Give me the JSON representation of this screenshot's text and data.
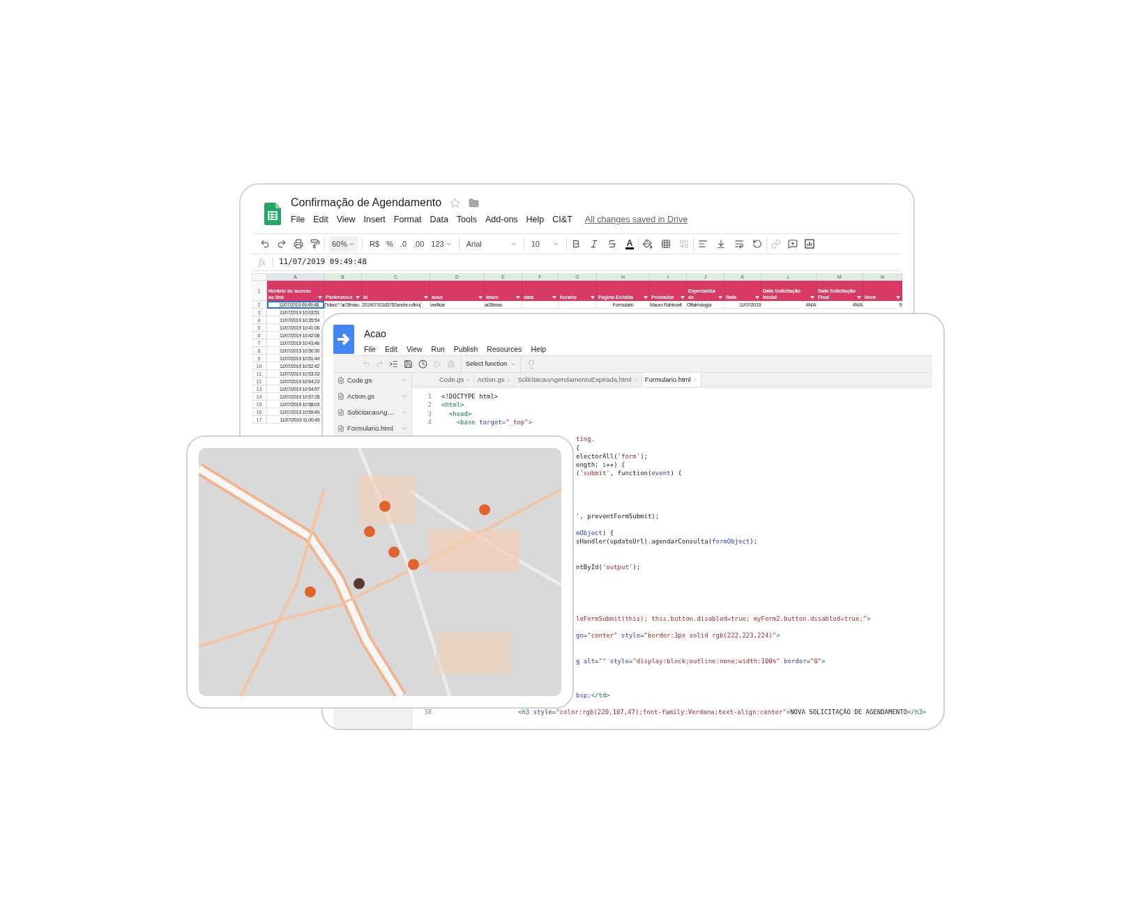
{
  "sheet_window": {
    "title": "Confirmação de Agendamento",
    "menu": [
      "File",
      "Edit",
      "View",
      "Insert",
      "Format",
      "Data",
      "Tools",
      "Add-ons",
      "Help",
      "CI&T"
    ],
    "save_status": "All changes saved in Drive",
    "toolbar": {
      "zoom": "60%",
      "currency": "R$",
      "percent": "%",
      "decrease_decimals": ".0",
      "increase_decimals": ".00",
      "more_formats": "123",
      "font": "Arial",
      "font_size": "10",
      "text_color": "A"
    },
    "formula_bar": {
      "label": "fx",
      "value": "11/07/2019 09:49:48"
    },
    "columns": [
      "A",
      "B",
      "C",
      "D",
      "E",
      "F",
      "G",
      "H",
      "I",
      "J",
      "K",
      "L",
      "M",
      "N"
    ],
    "header_row": {
      "number": "1",
      "cells": [
        "Horário do acesso ao link",
        "Parâmetros",
        "id",
        "acao",
        "idsec",
        "data",
        "horario",
        "Página Exibida",
        "Prestador",
        "Especialidade",
        "Data",
        "Data Solicitação Inicial",
        "Data Solicitação Final",
        "Hora"
      ]
    },
    "rows": [
      {
        "number": "2",
        "selected": true,
        "cells": [
          "11/07/2019 09:49:48",
          "{\"idsec\":\"ar28mau",
          "20190710183752andre.rufino(",
          "verificar",
          "ar28mau",
          null,
          null,
          "Formulário",
          "Mauro Rabinovit",
          "Oftalmologia",
          "11/07/2019",
          "#N/A",
          "#N/A",
          "9"
        ]
      },
      {
        "number": "3",
        "selected": false,
        "cells": [
          "11/07/2019 10:03:51"
        ]
      },
      {
        "number": "4",
        "selected": false,
        "cells": [
          "11/07/2019 10:35:54"
        ]
      },
      {
        "number": "5",
        "selected": false,
        "cells": [
          "11/07/2019 10:41:06"
        ]
      },
      {
        "number": "6",
        "selected": false,
        "cells": [
          "11/07/2019 10:42:08"
        ]
      },
      {
        "number": "7",
        "selected": false,
        "cells": [
          "11/07/2019 10:43:46"
        ]
      },
      {
        "number": "8",
        "selected": false,
        "cells": [
          "11/07/2019 10:50:30"
        ]
      },
      {
        "number": "9",
        "selected": false,
        "cells": [
          "11/07/2019 10:51:44"
        ]
      },
      {
        "number": "10",
        "selected": false,
        "cells": [
          "11/07/2019 10:52:42"
        ]
      },
      {
        "number": "11",
        "selected": false,
        "cells": [
          "11/07/2019 10:53:33"
        ]
      },
      {
        "number": "12",
        "selected": false,
        "cells": [
          "11/07/2019 10:54:23"
        ]
      },
      {
        "number": "13",
        "selected": false,
        "cells": [
          "11/07/2019 10:54:57"
        ]
      },
      {
        "number": "14",
        "selected": false,
        "cells": [
          "11/07/2019 10:57:28"
        ]
      },
      {
        "number": "15",
        "selected": false,
        "cells": [
          "11/07/2019 10:58:03"
        ]
      },
      {
        "number": "16",
        "selected": false,
        "cells": [
          "11/07/2019 10:59:49"
        ]
      },
      {
        "number": "17",
        "selected": false,
        "cells": [
          "11/07/2019 11:00:49"
        ]
      }
    ]
  },
  "script_window": {
    "title": "Acao",
    "menu": [
      "File",
      "Edit",
      "View",
      "Run",
      "Publish",
      "Resources",
      "Help"
    ],
    "toolbar": {
      "undo_disabled": true,
      "redo_disabled": true,
      "run_disabled": true,
      "debug_disabled": true,
      "select_function": "Select function"
    },
    "files": [
      "Code.gs",
      "Action.gs",
      "SolicitacaoAg…",
      "Formulario.html"
    ],
    "tabs": [
      {
        "label": "Code.gs",
        "selected": false
      },
      {
        "label": "Action.gs",
        "selected": false
      },
      {
        "label": "SolicitacaoAgendamentoExpirada.html",
        "selected": false
      },
      {
        "label": "Formulario.html",
        "selected": true
      }
    ],
    "code_lines": [
      {
        "kind": "head",
        "number": "1",
        "segments": [
          {
            "kind": "plain",
            "text": "<!DOCTYPE html>"
          }
        ]
      },
      {
        "kind": "head",
        "number": "2",
        "segments": [
          {
            "kind": "tag",
            "text": "<html>"
          }
        ]
      },
      {
        "kind": "head",
        "number": "3",
        "segments": [
          {
            "kind": "tag",
            "text": "  <head>"
          }
        ]
      },
      {
        "kind": "head",
        "number": "4",
        "segments": [
          {
            "kind": "tag",
            "text": "    <base "
          },
          {
            "kind": "attr",
            "text": "target"
          },
          {
            "kind": "tag",
            "text": "="
          },
          {
            "kind": "str",
            "text": "\"_top\""
          },
          {
            "kind": "tag",
            "text": ">"
          }
        ]
      },
      {
        "kind": "hidden"
      },
      {
        "kind": "tail",
        "segments": [
          {
            "kind": "str",
            "text": "ting."
          }
        ]
      },
      {
        "kind": "tail",
        "segments": [
          {
            "kind": "plain",
            "text": "{"
          }
        ]
      },
      {
        "kind": "tail",
        "segments": [
          {
            "kind": "plain",
            "text": "electorAll("
          },
          {
            "kind": "str",
            "text": "'form'"
          },
          {
            "kind": "plain",
            "text": ");"
          }
        ]
      },
      {
        "kind": "tail",
        "segments": [
          {
            "kind": "plain",
            "text": "ength; "
          },
          {
            "kind": "attr",
            "text": "i"
          },
          {
            "kind": "plain",
            "text": "++) {"
          }
        ]
      },
      {
        "kind": "tail",
        "segments": [
          {
            "kind": "plain",
            "text": "("
          },
          {
            "kind": "str",
            "text": "'submit'"
          },
          {
            "kind": "plain",
            "text": ", function("
          },
          {
            "kind": "attr",
            "text": "event"
          },
          {
            "kind": "plain",
            "text": ") {"
          }
        ]
      },
      {
        "kind": "hidden"
      },
      {
        "kind": "hidden"
      },
      {
        "kind": "hidden"
      },
      {
        "kind": "hidden"
      },
      {
        "kind": "tail",
        "segments": [
          {
            "kind": "str",
            "text": "'"
          },
          {
            "kind": "plain",
            "text": ", preventFormSubmit);"
          }
        ]
      },
      {
        "kind": "hidden"
      },
      {
        "kind": "tail",
        "segments": [
          {
            "kind": "attr",
            "text": "mObject"
          },
          {
            "kind": "plain",
            "text": ") {"
          }
        ]
      },
      {
        "kind": "tail",
        "segments": [
          {
            "kind": "plain",
            "text": "sHandler(updateUrl).agendarConsulta("
          },
          {
            "kind": "attr",
            "text": "formObject"
          },
          {
            "kind": "plain",
            "text": ");"
          }
        ]
      },
      {
        "kind": "hidden"
      },
      {
        "kind": "hidden"
      },
      {
        "kind": "tail",
        "segments": [
          {
            "kind": "plain",
            "text": "ntById("
          },
          {
            "kind": "str",
            "text": "'output'"
          },
          {
            "kind": "plain",
            "text": ");"
          }
        ]
      },
      {
        "kind": "hidden"
      },
      {
        "kind": "hidden"
      },
      {
        "kind": "hidden"
      },
      {
        "kind": "hidden"
      },
      {
        "kind": "hidden"
      },
      {
        "kind": "tail",
        "segments": [
          {
            "kind": "str",
            "text": "leFormSubmit(this); this.button.disabled=true; myForm2.button.disabled=true;\""
          },
          {
            "kind": "tag",
            "text": ">"
          }
        ]
      },
      {
        "kind": "hidden"
      },
      {
        "kind": "tail",
        "segments": [
          {
            "kind": "attr",
            "text": "gn"
          },
          {
            "kind": "plain",
            "text": "="
          },
          {
            "kind": "str",
            "text": "\"center\""
          },
          {
            "kind": "attr",
            "text": " style"
          },
          {
            "kind": "plain",
            "text": "="
          },
          {
            "kind": "str",
            "text": "\"border:3px solid rgb(222,223,224)\""
          },
          {
            "kind": "tag",
            "text": ">"
          }
        ]
      },
      {
        "kind": "hidden"
      },
      {
        "kind": "hidden"
      },
      {
        "kind": "tail",
        "segments": [
          {
            "kind": "attr",
            "text": "g alt"
          },
          {
            "kind": "plain",
            "text": "="
          },
          {
            "kind": "str",
            "text": "\"\""
          },
          {
            "kind": "attr",
            "text": " style"
          },
          {
            "kind": "plain",
            "text": "="
          },
          {
            "kind": "str",
            "text": "\"display:block;outline:none;width:100%\""
          },
          {
            "kind": "attr",
            "text": " border"
          },
          {
            "kind": "plain",
            "text": "="
          },
          {
            "kind": "str",
            "text": "\"0\""
          },
          {
            "kind": "tag",
            "text": ">"
          }
        ]
      },
      {
        "kind": "hidden"
      },
      {
        "kind": "hidden"
      },
      {
        "kind": "hidden"
      },
      {
        "kind": "tail",
        "segments": [
          {
            "kind": "attr",
            "text": "bsp;"
          },
          {
            "kind": "tag",
            "text": "</td>"
          }
        ]
      },
      {
        "kind": "hidden"
      },
      {
        "kind": "low",
        "number": "38",
        "segments": [
          {
            "kind": "tag",
            "text": "<h3 "
          },
          {
            "kind": "attr",
            "text": "style"
          },
          {
            "kind": "plain",
            "text": "="
          },
          {
            "kind": "str",
            "text": "\"color:rgb(220,107,47);font-family:Verdana;text-align:center\""
          },
          {
            "kind": "tag",
            "text": ">"
          },
          {
            "kind": "plain",
            "text": "NOVA SOLICITAÇÃO DE AGENDAMENTO"
          },
          {
            "kind": "tag",
            "text": "</h3>"
          }
        ]
      }
    ]
  }
}
